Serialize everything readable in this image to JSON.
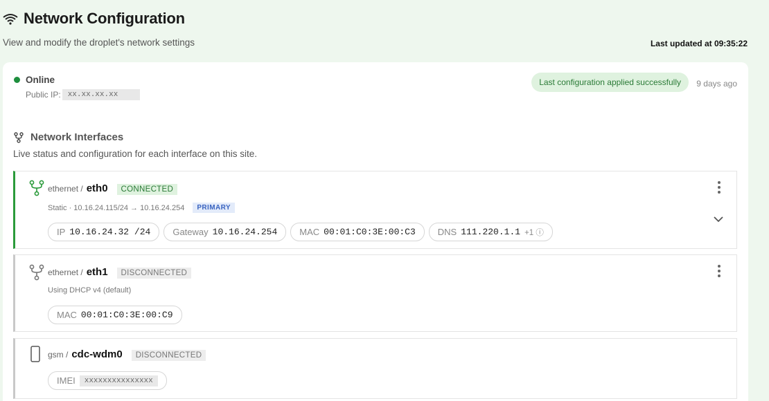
{
  "page": {
    "title": "Network Configuration",
    "subtitle": "View and modify the droplet's network settings",
    "last_updated": "Last updated at 09:35:22"
  },
  "status": {
    "state": "Online",
    "public_ip_label": "Public IP:",
    "public_ip_value": "xx.xx.xx.xx",
    "apply_message": "Last configuration applied successfully",
    "apply_ago": "9 days ago"
  },
  "interfaces_section": {
    "title": "Network Interfaces",
    "subtitle": "Live status and configuration for each interface on this site."
  },
  "interfaces": [
    {
      "type": "ethernet /",
      "name": "eth0",
      "status": "CONNECTED",
      "detail": "Static · 10.16.24.115/24 → 10.16.24.254",
      "primary_badge": "PRIMARY",
      "chips": {
        "ip_label": "IP",
        "ip_value": "10.16.24.32 /24",
        "gateway_label": "Gateway",
        "gateway_value": "10.16.24.254",
        "mac_label": "MAC",
        "mac_value": "00:01:C0:3E:00:C3",
        "dns_label": "DNS",
        "dns_value": "111.220.1.1",
        "dns_extra": "+1 ⓘ"
      },
      "icon": "fork-icon"
    },
    {
      "type": "ethernet /",
      "name": "eth1",
      "status": "DISCONNECTED",
      "detail": "Using DHCP v4 (default)",
      "chips": {
        "mac_label": "MAC",
        "mac_value": "00:01:C0:3E:00:C9"
      },
      "icon": "fork-icon"
    },
    {
      "type": "gsm /",
      "name": "cdc-wdm0",
      "status": "DISCONNECTED",
      "chips": {
        "imei_label": "IMEI",
        "imei_value": "xxxxxxxxxxxxxxx"
      },
      "icon": "phone-icon"
    }
  ],
  "colors": {
    "page_bg": "#eef7ee",
    "connected_green": "#2a9a3a",
    "primary_blue": "#3a64c0"
  }
}
